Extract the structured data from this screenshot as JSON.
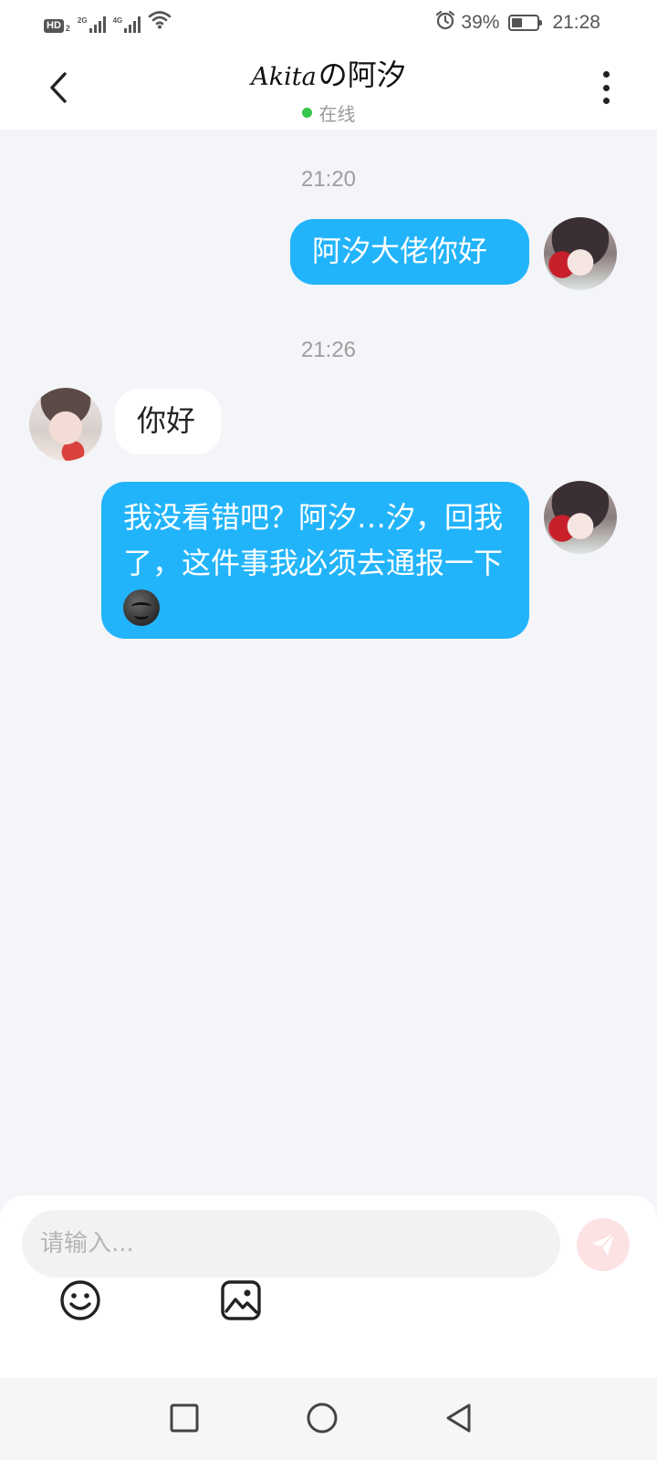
{
  "status_bar": {
    "hd_label": "HD",
    "hd_sub": "2",
    "network_1": "2G",
    "network_2": "4G",
    "battery_percent": "39%",
    "battery_level": 0.39,
    "time": "21:28",
    "icons": [
      "signal-icon",
      "wifi-icon",
      "alarm-icon",
      "battery-icon"
    ]
  },
  "header": {
    "title_script": "Akita",
    "title_cn": "の阿汐",
    "status": "在线",
    "status_color": "#35c64b",
    "back_icon": "chevron-left-icon",
    "menu_icon": "more-vertical-icon"
  },
  "chat": {
    "messages": [
      {
        "type": "time",
        "text": "21:20"
      },
      {
        "type": "sent",
        "text": "阿汐大佬你好"
      },
      {
        "type": "time",
        "text": "21:26"
      },
      {
        "type": "received",
        "text": "你好"
      },
      {
        "type": "sent",
        "text": "我没看错吧？阿汐…汐，回我了，这件事我必须去通报一下",
        "emoji": "smirk-face-icon"
      }
    ],
    "sent_bubble_color": "#22b4fb",
    "received_bubble_color": "#ffffff"
  },
  "input": {
    "placeholder": "请输入...",
    "value": "",
    "send_icon": "send-icon",
    "tools": [
      "emoji-icon",
      "image-icon"
    ]
  },
  "nav": {
    "buttons": [
      "recent-apps-icon",
      "home-icon",
      "back-icon"
    ]
  }
}
